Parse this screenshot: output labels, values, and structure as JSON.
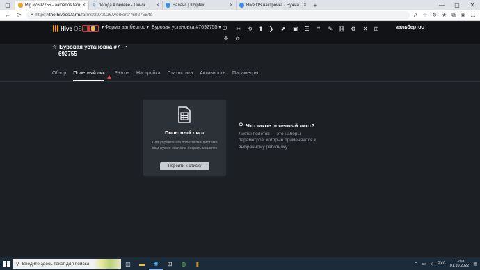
{
  "browser": {
    "tabs": [
      {
        "title": "Rig #7692755 - aalbertos farm",
        "icon": "hive-icon",
        "active": true
      },
      {
        "title": "погода в белёве - Поиск",
        "icon": "search-icon",
        "active": false
      },
      {
        "title": "Баланс | Kryptex",
        "icon": "kryptex-icon",
        "active": false
      },
      {
        "title": "Hive OS настройка - Нужна пом",
        "icon": "kryptex-icon",
        "active": false
      }
    ],
    "url_scheme": "https://",
    "url_host": "the.hiveos.farm",
    "url_path": "/farms/2979026/workers/7692755/fs"
  },
  "header": {
    "logo_main": "Hive",
    "logo_sub": "OS",
    "farm_label": "Ферма аалбертос",
    "worker_label": "Буровая установка #7692755",
    "username": "аальбертос"
  },
  "rig": {
    "title": "Буровая установка #7",
    "id": "692755"
  },
  "subtabs": [
    {
      "label": "Обзор",
      "active": false
    },
    {
      "label": "Полетный лист",
      "active": true,
      "warning": true
    },
    {
      "label": "Разгон",
      "active": false
    },
    {
      "label": "Настройка",
      "active": false
    },
    {
      "label": "Статистика",
      "active": false
    },
    {
      "label": "Активность",
      "active": false
    },
    {
      "label": "Параметры",
      "active": false
    }
  ],
  "card": {
    "title": "Полетный лист",
    "description": "Для управления полетными листами вам нужно сначала создать кошелек",
    "button": "Перейти к списку"
  },
  "info": {
    "title": "Что такое полетный лист?",
    "text": "Листы полетов — это наборы параметров, которые применяются к выбранному работнику."
  },
  "taskbar": {
    "search_placeholder": "Введите здесь текст для поиска",
    "language": "РУС",
    "time": "13:03",
    "date": "01.10.2022"
  },
  "colors": {
    "accent": "#f0a020",
    "warning": "#e04848",
    "background": "#1c1f24",
    "card": "#2c3037"
  }
}
